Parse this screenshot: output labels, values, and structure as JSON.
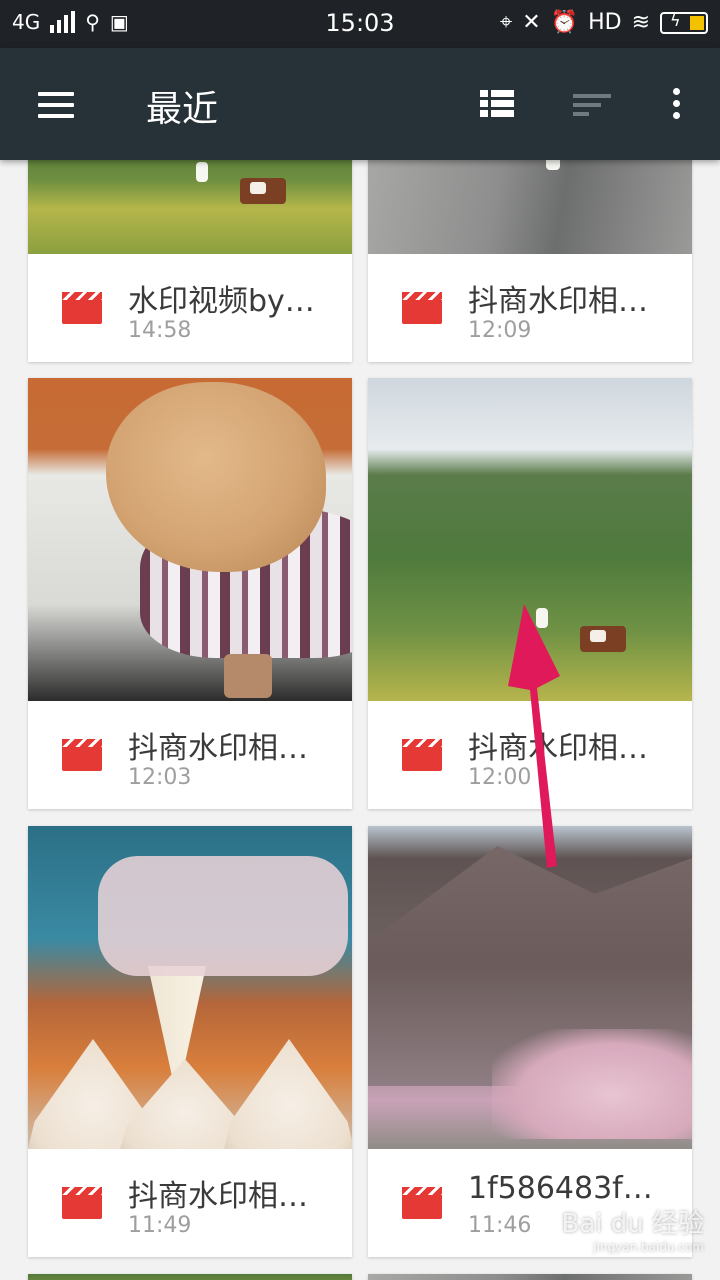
{
  "status_bar": {
    "network": "4G",
    "time": "15:03",
    "hd": "HD"
  },
  "app_bar": {
    "title": "最近"
  },
  "files": [
    {
      "name": "水印视频by…",
      "time": "14:58"
    },
    {
      "name": "抖商水印相…",
      "time": "12:09"
    },
    {
      "name": "抖商水印相…",
      "time": "12:03"
    },
    {
      "name": "抖商水印相…",
      "time": "12:00"
    },
    {
      "name": "抖商水印相…",
      "time": "11:49"
    },
    {
      "name": "1f586483f…",
      "time": "11:46"
    }
  ],
  "watermark": {
    "brand": "Bai du 经验",
    "url": "jingyan.baidu.com"
  },
  "colors": {
    "app_bar": "#263238",
    "status_bar": "#1f2327",
    "video_icon": "#e53935",
    "annotation_arrow": "#e0195a"
  }
}
